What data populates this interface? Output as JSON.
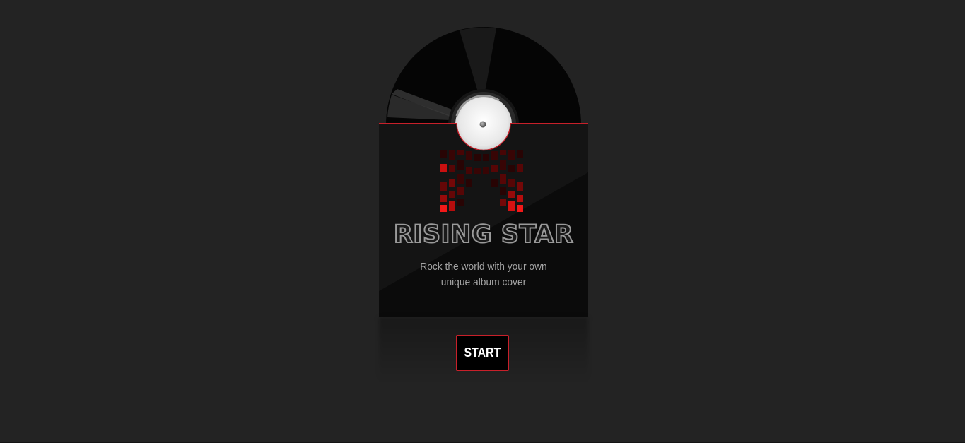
{
  "album": {
    "title": "RISING STAR",
    "subtitle": "Rock the world with your own unique album cover"
  },
  "actions": {
    "start_label": "START"
  },
  "icons": {
    "record": "vinyl-record-icon",
    "equalizer": "equalizer-icon"
  },
  "colors": {
    "background": "#232323",
    "accent": "#c8202a",
    "sleeve": "#0b0b0b",
    "title_stroke": "#9a9a9a",
    "subtitle": "#a3a3a3"
  }
}
